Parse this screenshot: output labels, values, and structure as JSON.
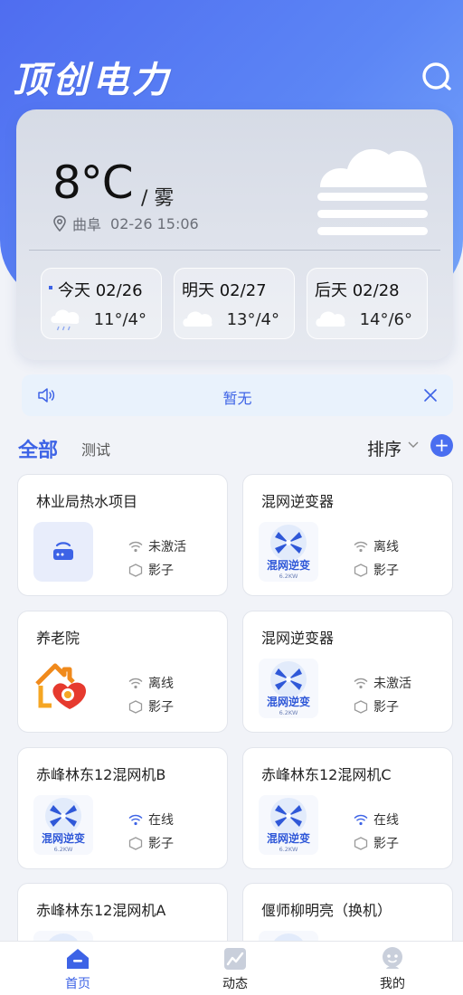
{
  "app": {
    "brand": "顶创电力"
  },
  "weather": {
    "temperature": "8°C",
    "condition": "/ 雾",
    "location": "曲阜",
    "datetime": "02-26 15:06",
    "forecast": [
      {
        "label": "今天 02/26",
        "range": "11°/4°",
        "icon": "rain-cloud-icon"
      },
      {
        "label": "明天 02/27",
        "range": "13°/4°",
        "icon": "cloud-icon"
      },
      {
        "label": "后天 02/28",
        "range": "14°/6°",
        "icon": "cloud-icon"
      }
    ]
  },
  "notice": {
    "text": "暂无"
  },
  "filters": {
    "all": "全部",
    "test": "测试",
    "sort": "排序",
    "add": "+"
  },
  "devices": [
    {
      "name": "林业局热水项目",
      "status": "未激活",
      "shadow": "影子",
      "thumb": "router-icon",
      "online": false
    },
    {
      "name": "混网逆变器",
      "status": "离线",
      "shadow": "影子",
      "thumb": "inverter-logo",
      "online": false
    },
    {
      "name": "养老院",
      "status": "离线",
      "shadow": "影子",
      "thumb": "elderly-home-logo",
      "online": false
    },
    {
      "name": "混网逆变器",
      "status": "未激活",
      "shadow": "影子",
      "thumb": "inverter-logo",
      "online": false
    },
    {
      "name": "赤峰林东12混网机B",
      "status": "在线",
      "shadow": "影子",
      "thumb": "inverter-logo",
      "online": true
    },
    {
      "name": "赤峰林东12混网机C",
      "status": "在线",
      "shadow": "影子",
      "thumb": "inverter-logo",
      "online": true
    },
    {
      "name": "赤峰林东12混网机A",
      "thumb": "inverter-logo"
    },
    {
      "name": "偃师柳明亮（换机）",
      "thumb": "inverter-logo"
    }
  ],
  "inverter_logo": {
    "title": "混网逆变",
    "power": "6.2KW"
  },
  "nav": [
    {
      "label": "首页",
      "icon": "home-icon",
      "active": true
    },
    {
      "label": "动态",
      "icon": "chart-icon",
      "active": false
    },
    {
      "label": "我的",
      "icon": "profile-icon",
      "active": false
    }
  ],
  "colors": {
    "accent": "#3d63e6",
    "hero_start": "#4f6df0",
    "hero_end": "#78a7fb",
    "online": "#3d63e6",
    "offline": "#999999"
  }
}
